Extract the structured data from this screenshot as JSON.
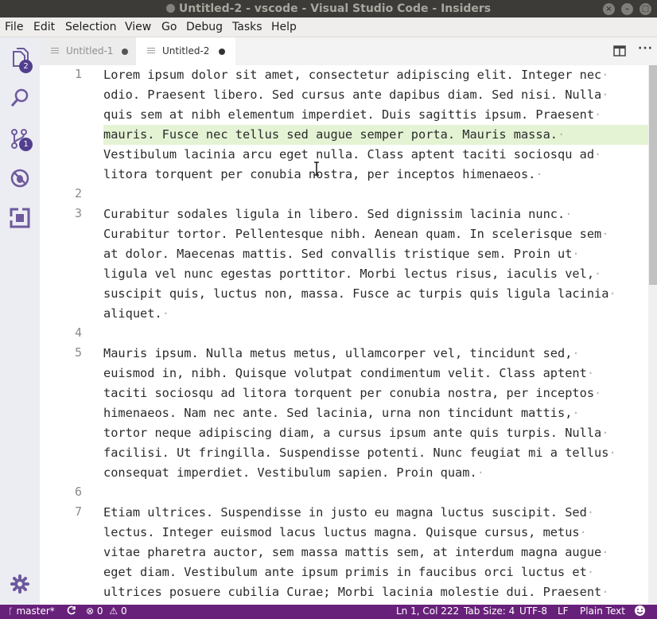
{
  "window": {
    "title": "Untitled-2 - vscode - Visual Studio Code - Insiders"
  },
  "menu": [
    "File",
    "Edit",
    "Selection",
    "View",
    "Go",
    "Debug",
    "Tasks",
    "Help"
  ],
  "activity": {
    "explorer_badge": "2",
    "scm_badge": "1",
    "icons": [
      "files-icon",
      "search-icon",
      "source-control-icon",
      "debug-icon",
      "extensions-icon",
      "gear-icon"
    ]
  },
  "tabs": [
    {
      "label": "Untitled-1",
      "active": false,
      "dirty": true
    },
    {
      "label": "Untitled-2",
      "active": true,
      "dirty": true
    }
  ],
  "editor": {
    "lines": [
      {
        "number": "1",
        "wrapped": [
          "Lorem ipsum dolor sit amet, consectetur adipiscing elit. Integer nec",
          "odio. Praesent libero. Sed cursus ante dapibus diam. Sed nisi. Nulla",
          "quis sem at nibh elementum imperdiet. Duis sagittis ipsum. Praesent",
          "mauris. Fusce nec tellus sed augue semper porta. Mauris massa.",
          "Vestibulum lacinia arcu eget nulla. Class aptent taciti sociosqu ad",
          "litora torquent per conubia nostra, per inceptos himenaeos."
        ]
      },
      {
        "number": "2",
        "wrapped": [
          ""
        ]
      },
      {
        "number": "3",
        "wrapped": [
          "Curabitur sodales ligula in libero. Sed dignissim lacinia nunc.",
          "Curabitur tortor. Pellentesque nibh. Aenean quam. In scelerisque sem",
          "at dolor. Maecenas mattis. Sed convallis tristique sem. Proin ut",
          "ligula vel nunc egestas porttitor. Morbi lectus risus, iaculis vel,",
          "suscipit quis, luctus non, massa. Fusce ac turpis quis ligula lacinia",
          "aliquet."
        ]
      },
      {
        "number": "4",
        "wrapped": [
          ""
        ]
      },
      {
        "number": "5",
        "wrapped": [
          "Mauris ipsum. Nulla metus metus, ullamcorper vel, tincidunt sed,",
          "euismod in, nibh. Quisque volutpat condimentum velit. Class aptent",
          "taciti sociosqu ad litora torquent per conubia nostra, per inceptos",
          "himenaeos. Nam nec ante. Sed lacinia, urna non tincidunt mattis,",
          "tortor neque adipiscing diam, a cursus ipsum ante quis turpis. Nulla",
          "facilisi. Ut fringilla. Suspendisse potenti. Nunc feugiat mi a tellus",
          "consequat imperdiet. Vestibulum sapien. Proin quam."
        ]
      },
      {
        "number": "6",
        "wrapped": [
          ""
        ]
      },
      {
        "number": "7",
        "wrapped": [
          "Etiam ultrices. Suspendisse in justo eu magna luctus suscipit. Sed",
          "lectus. Integer euismod lacus luctus magna. Quisque cursus, metus",
          "vitae pharetra auctor, sem massa mattis sem, at interdum magna augue",
          "eget diam. Vestibulum ante ipsum primis in faucibus orci luctus et",
          "ultrices posuere cubilia Curae; Morbi lacinia molestie dui. Praesent"
        ]
      }
    ]
  },
  "status": {
    "branch": "master*",
    "errors": "0",
    "warnings": "0",
    "position": "Ln 1, Col 222",
    "tab_size": "Tab Size: 4",
    "encoding": "UTF-8",
    "eol": "LF",
    "language": "Plain Text"
  },
  "colors": {
    "title_bar": "#3c3b37",
    "menu_bar": "#efeeed",
    "activity_bar": "#ececf3",
    "status_bar": "#68217a",
    "badge": "#523e8e",
    "line_highlight": "#e4f3d4"
  }
}
